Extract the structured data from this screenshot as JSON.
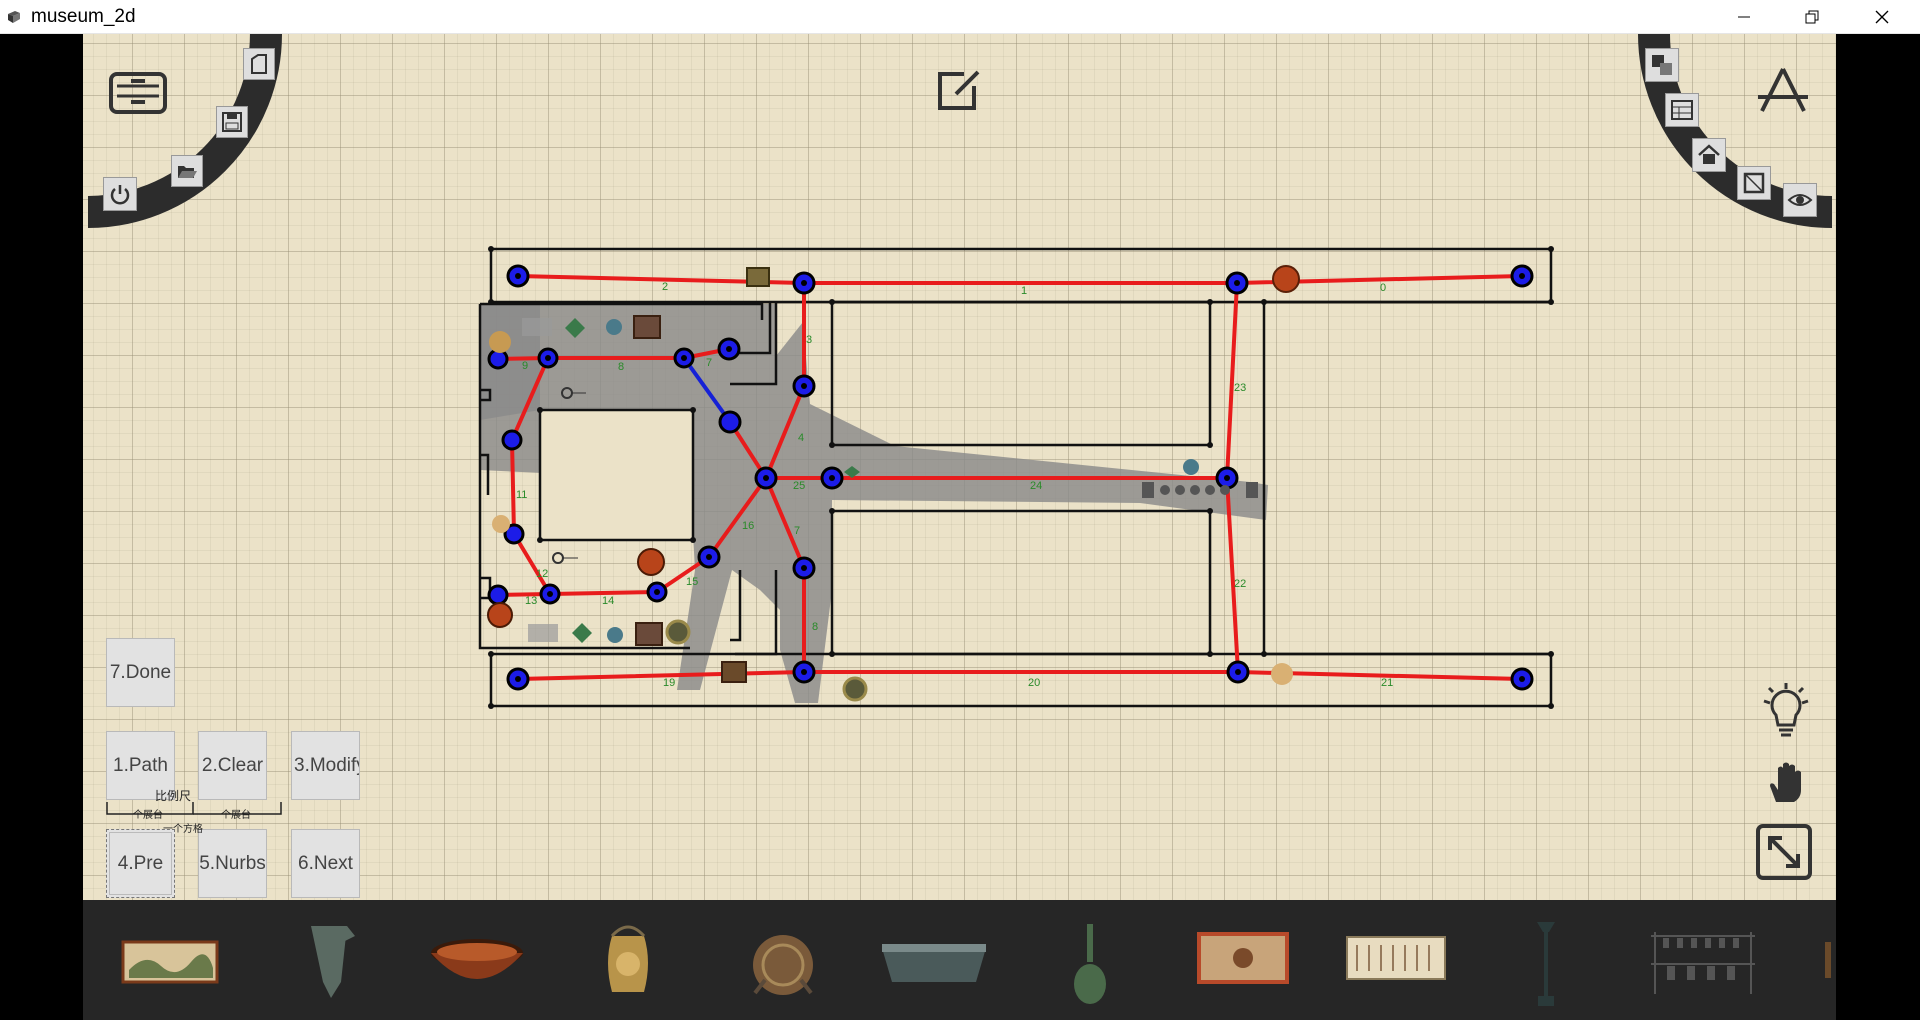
{
  "window": {
    "title": "museum_2d"
  },
  "controls": {
    "done_label": "7.Done",
    "path_label": "1.Path",
    "clear_label": "2.Clear",
    "modify_label": "3.Modify",
    "pre_label": "4.Pre",
    "nurbs_label": "5.Nurbs",
    "next_label": "6.Next"
  },
  "scale": {
    "title": "比例尺",
    "label_left": "一个展台",
    "label_right": "一个展台",
    "label_bottom": "一个方格"
  },
  "top_left_menu": [
    "cabinet-icon",
    "new-page-icon",
    "save-icon",
    "folder-open-icon",
    "power-icon"
  ],
  "top_right_menu": [
    "app-store-icon",
    "layers-icon",
    "table-icon",
    "home-icon",
    "frame-icon",
    "eye-icon"
  ],
  "edge_labels": [
    "0",
    "1",
    "2",
    "3",
    "4",
    "5",
    "6",
    "7",
    "8",
    "9",
    "11",
    "12",
    "13",
    "14",
    "15",
    "16",
    "19",
    "20",
    "21",
    "22",
    "23",
    "24",
    "25"
  ],
  "colors": {
    "path_red": "#e81c1c",
    "path_blue": "#1621d6",
    "node_fill": "#1c1ce8",
    "node_outline": "#000000",
    "wall": "#111111",
    "floor_shadow": "#8a8a8a",
    "label_green": "#2a8a2a"
  },
  "artifacts": [
    "painting-scroll",
    "bronze-vessel",
    "lacquer-bowl",
    "gilded-jar",
    "bronze-censer",
    "bronze-basin",
    "celadon-vase",
    "silk-painting",
    "calligraphy-scroll",
    "bronze-lamp",
    "bronze-bells"
  ]
}
